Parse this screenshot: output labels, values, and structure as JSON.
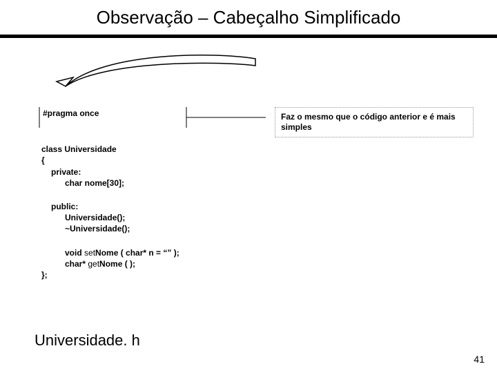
{
  "title": "Observação – Cabeçalho Simplificado",
  "callout": "Faz o mesmo que o código anterior e é mais simples",
  "code": {
    "pragma": "#pragma once",
    "class_decl": "class Universidade",
    "open_brace": "{",
    "private_kw": "private:",
    "member1": "char nome[30];",
    "public_kw": "public:",
    "ctor": "Universidade();",
    "dtor": "~Universidade();",
    "set_pre": "void ",
    "set_mid": "set",
    "set_post": "Nome ( char* n  = “” );",
    "get_pre": "char* ",
    "get_mid": "get",
    "get_post": "Nome ( );",
    "close": "};"
  },
  "filename": "Universidade. h",
  "pagenum": "41"
}
